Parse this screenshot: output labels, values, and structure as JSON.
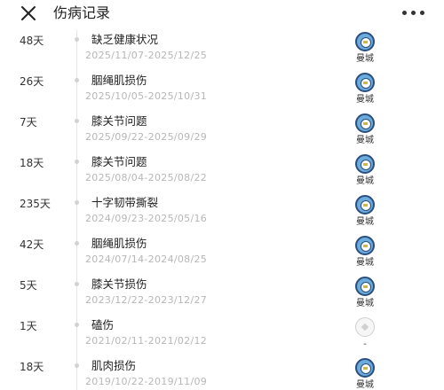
{
  "header": {
    "title": "伤病记录"
  },
  "injuries": [
    {
      "duration": "48天",
      "type": "缺乏健康状况",
      "dates": "2025/11/07-2025/12/25",
      "club": "曼城",
      "club_icon": "man-city-badge-icon"
    },
    {
      "duration": "26天",
      "type": "胭绳肌损伤",
      "dates": "2025/10/05-2025/10/31",
      "club": "曼城",
      "club_icon": "man-city-badge-icon"
    },
    {
      "duration": "7天",
      "type": "膝关节问题",
      "dates": "2025/09/22-2025/09/29",
      "club": "曼城",
      "club_icon": "man-city-badge-icon"
    },
    {
      "duration": "18天",
      "type": "膝关节问题",
      "dates": "2025/08/04-2025/08/22",
      "club": "曼城",
      "club_icon": "man-city-badge-icon"
    },
    {
      "duration": "235天",
      "type": "十字韧带撕裂",
      "dates": "2024/09/23-2025/05/16",
      "club": "曼城",
      "club_icon": "man-city-badge-icon"
    },
    {
      "duration": "42天",
      "type": "胭绳肌损伤",
      "dates": "2024/07/14-2024/08/25",
      "club": "曼城",
      "club_icon": "man-city-badge-icon"
    },
    {
      "duration": "5天",
      "type": "膝关节损伤",
      "dates": "2023/12/22-2023/12/27",
      "club": "曼城",
      "club_icon": "man-city-badge-icon"
    },
    {
      "duration": "1天",
      "type": "磕伤",
      "dates": "2021/02/11-2021/02/12",
      "club": "-",
      "club_icon": "football-placeholder-icon"
    },
    {
      "duration": "18天",
      "type": "肌肉损伤",
      "dates": "2019/10/22-2019/11/09",
      "club": "曼城",
      "club_icon": "man-city-badge-icon"
    }
  ]
}
